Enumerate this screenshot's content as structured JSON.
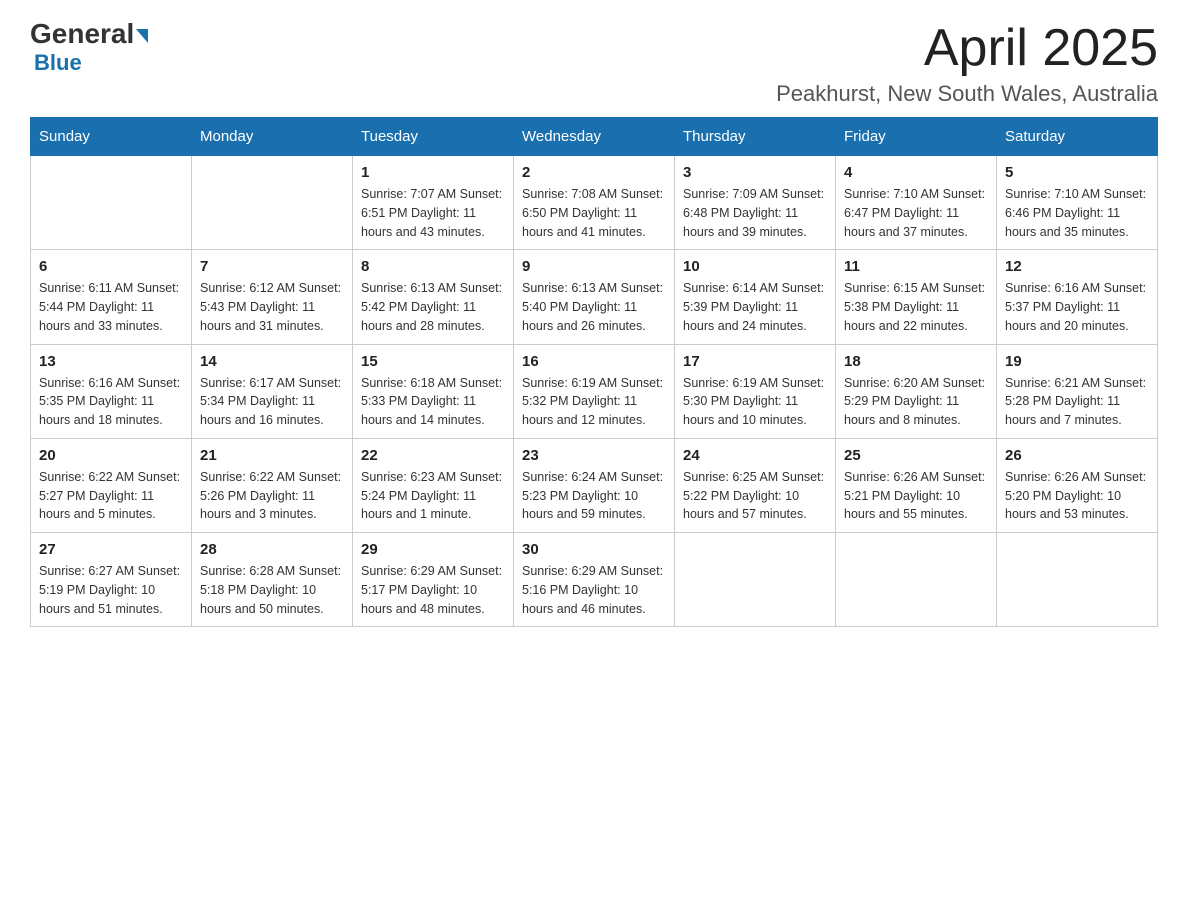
{
  "header": {
    "logo_main": "General",
    "logo_sub": "Blue",
    "month_title": "April 2025",
    "location": "Peakhurst, New South Wales, Australia"
  },
  "weekdays": [
    "Sunday",
    "Monday",
    "Tuesday",
    "Wednesday",
    "Thursday",
    "Friday",
    "Saturday"
  ],
  "weeks": [
    [
      {
        "day": "",
        "info": ""
      },
      {
        "day": "",
        "info": ""
      },
      {
        "day": "1",
        "info": "Sunrise: 7:07 AM\nSunset: 6:51 PM\nDaylight: 11 hours\nand 43 minutes."
      },
      {
        "day": "2",
        "info": "Sunrise: 7:08 AM\nSunset: 6:50 PM\nDaylight: 11 hours\nand 41 minutes."
      },
      {
        "day": "3",
        "info": "Sunrise: 7:09 AM\nSunset: 6:48 PM\nDaylight: 11 hours\nand 39 minutes."
      },
      {
        "day": "4",
        "info": "Sunrise: 7:10 AM\nSunset: 6:47 PM\nDaylight: 11 hours\nand 37 minutes."
      },
      {
        "day": "5",
        "info": "Sunrise: 7:10 AM\nSunset: 6:46 PM\nDaylight: 11 hours\nand 35 minutes."
      }
    ],
    [
      {
        "day": "6",
        "info": "Sunrise: 6:11 AM\nSunset: 5:44 PM\nDaylight: 11 hours\nand 33 minutes."
      },
      {
        "day": "7",
        "info": "Sunrise: 6:12 AM\nSunset: 5:43 PM\nDaylight: 11 hours\nand 31 minutes."
      },
      {
        "day": "8",
        "info": "Sunrise: 6:13 AM\nSunset: 5:42 PM\nDaylight: 11 hours\nand 28 minutes."
      },
      {
        "day": "9",
        "info": "Sunrise: 6:13 AM\nSunset: 5:40 PM\nDaylight: 11 hours\nand 26 minutes."
      },
      {
        "day": "10",
        "info": "Sunrise: 6:14 AM\nSunset: 5:39 PM\nDaylight: 11 hours\nand 24 minutes."
      },
      {
        "day": "11",
        "info": "Sunrise: 6:15 AM\nSunset: 5:38 PM\nDaylight: 11 hours\nand 22 minutes."
      },
      {
        "day": "12",
        "info": "Sunrise: 6:16 AM\nSunset: 5:37 PM\nDaylight: 11 hours\nand 20 minutes."
      }
    ],
    [
      {
        "day": "13",
        "info": "Sunrise: 6:16 AM\nSunset: 5:35 PM\nDaylight: 11 hours\nand 18 minutes."
      },
      {
        "day": "14",
        "info": "Sunrise: 6:17 AM\nSunset: 5:34 PM\nDaylight: 11 hours\nand 16 minutes."
      },
      {
        "day": "15",
        "info": "Sunrise: 6:18 AM\nSunset: 5:33 PM\nDaylight: 11 hours\nand 14 minutes."
      },
      {
        "day": "16",
        "info": "Sunrise: 6:19 AM\nSunset: 5:32 PM\nDaylight: 11 hours\nand 12 minutes."
      },
      {
        "day": "17",
        "info": "Sunrise: 6:19 AM\nSunset: 5:30 PM\nDaylight: 11 hours\nand 10 minutes."
      },
      {
        "day": "18",
        "info": "Sunrise: 6:20 AM\nSunset: 5:29 PM\nDaylight: 11 hours\nand 8 minutes."
      },
      {
        "day": "19",
        "info": "Sunrise: 6:21 AM\nSunset: 5:28 PM\nDaylight: 11 hours\nand 7 minutes."
      }
    ],
    [
      {
        "day": "20",
        "info": "Sunrise: 6:22 AM\nSunset: 5:27 PM\nDaylight: 11 hours\nand 5 minutes."
      },
      {
        "day": "21",
        "info": "Sunrise: 6:22 AM\nSunset: 5:26 PM\nDaylight: 11 hours\nand 3 minutes."
      },
      {
        "day": "22",
        "info": "Sunrise: 6:23 AM\nSunset: 5:24 PM\nDaylight: 11 hours\nand 1 minute."
      },
      {
        "day": "23",
        "info": "Sunrise: 6:24 AM\nSunset: 5:23 PM\nDaylight: 10 hours\nand 59 minutes."
      },
      {
        "day": "24",
        "info": "Sunrise: 6:25 AM\nSunset: 5:22 PM\nDaylight: 10 hours\nand 57 minutes."
      },
      {
        "day": "25",
        "info": "Sunrise: 6:26 AM\nSunset: 5:21 PM\nDaylight: 10 hours\nand 55 minutes."
      },
      {
        "day": "26",
        "info": "Sunrise: 6:26 AM\nSunset: 5:20 PM\nDaylight: 10 hours\nand 53 minutes."
      }
    ],
    [
      {
        "day": "27",
        "info": "Sunrise: 6:27 AM\nSunset: 5:19 PM\nDaylight: 10 hours\nand 51 minutes."
      },
      {
        "day": "28",
        "info": "Sunrise: 6:28 AM\nSunset: 5:18 PM\nDaylight: 10 hours\nand 50 minutes."
      },
      {
        "day": "29",
        "info": "Sunrise: 6:29 AM\nSunset: 5:17 PM\nDaylight: 10 hours\nand 48 minutes."
      },
      {
        "day": "30",
        "info": "Sunrise: 6:29 AM\nSunset: 5:16 PM\nDaylight: 10 hours\nand 46 minutes."
      },
      {
        "day": "",
        "info": ""
      },
      {
        "day": "",
        "info": ""
      },
      {
        "day": "",
        "info": ""
      }
    ]
  ]
}
